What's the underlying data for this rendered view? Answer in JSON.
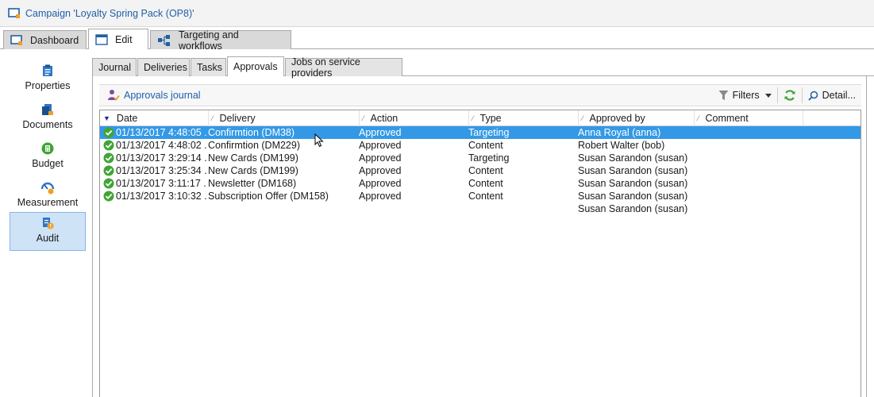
{
  "window": {
    "title": "Campaign 'Loyalty Spring Pack (OP8)'"
  },
  "top_tabs": [
    {
      "label": "Dashboard",
      "icon": "dashboard-icon"
    },
    {
      "label": "Edit",
      "icon": "edit-icon",
      "active": true
    },
    {
      "label": "Targeting and workflows",
      "icon": "workflow-icon"
    }
  ],
  "sidebar": {
    "items": [
      {
        "label": "Properties",
        "icon": "properties-icon"
      },
      {
        "label": "Documents",
        "icon": "documents-icon"
      },
      {
        "label": "Budget",
        "icon": "budget-icon"
      },
      {
        "label": "Measurement",
        "icon": "measurement-icon"
      },
      {
        "label": "Audit",
        "icon": "audit-icon",
        "selected": true
      }
    ]
  },
  "inner_tabs": [
    {
      "label": "Journal"
    },
    {
      "label": "Deliveries"
    },
    {
      "label": "Tasks"
    },
    {
      "label": "Approvals",
      "active": true
    },
    {
      "label": "Jobs on service providers"
    }
  ],
  "toolbar": {
    "approvals_journal": "Approvals journal",
    "filters": "Filters",
    "detail": "Detail..."
  },
  "table": {
    "columns": [
      "Date",
      "Delivery",
      "Action",
      "Type",
      "Approved by",
      "Comment"
    ],
    "rows": [
      {
        "date": "01/13/2017 4:48:05 ...",
        "delivery": "Confirmtion (DM38)",
        "action": "Approved",
        "type": "Targeting",
        "approved_by": "Anna Royal (anna)",
        "comment": "",
        "status": "approved",
        "selected": true
      },
      {
        "date": "01/13/2017 4:48:02 ...",
        "delivery": "Confirmtion (DM229)",
        "action": "Approved",
        "type": "Content",
        "approved_by": "Robert Walter (bob)",
        "comment": "",
        "status": "approved"
      },
      {
        "date": "01/13/2017 3:29:14 ...",
        "delivery": "New Cards (DM199)",
        "action": "Approved",
        "type": "Targeting",
        "approved_by": "Susan Sarandon (susan)",
        "comment": "",
        "status": "approved"
      },
      {
        "date": "01/13/2017 3:25:34 ...",
        "delivery": "New Cards (DM199)",
        "action": "Approved",
        "type": "Content",
        "approved_by": "Susan Sarandon (susan)",
        "comment": "",
        "status": "approved"
      },
      {
        "date": "01/13/2017 3:11:17 ...",
        "delivery": "Newsletter (DM168)",
        "action": "Approved",
        "type": "Content",
        "approved_by": "Susan Sarandon (susan)",
        "comment": "",
        "status": "approved"
      },
      {
        "date": "01/13/2017 3:10:32 ...",
        "delivery": "Subscription Offer (DM158)",
        "action": "Approved",
        "type": "Content",
        "approved_by": "Susan Sarandon (susan)",
        "comment": "",
        "status": "approved"
      },
      {
        "date": "",
        "delivery": "",
        "action": "",
        "type": "",
        "approved_by": "Susan Sarandon (susan)",
        "comment": "",
        "status": ""
      }
    ]
  },
  "colors": {
    "accent": "#1f5fa8",
    "selection": "#3399e6",
    "approved_green": "#3fa535",
    "sidebar_selected": "#cfe3f7"
  }
}
